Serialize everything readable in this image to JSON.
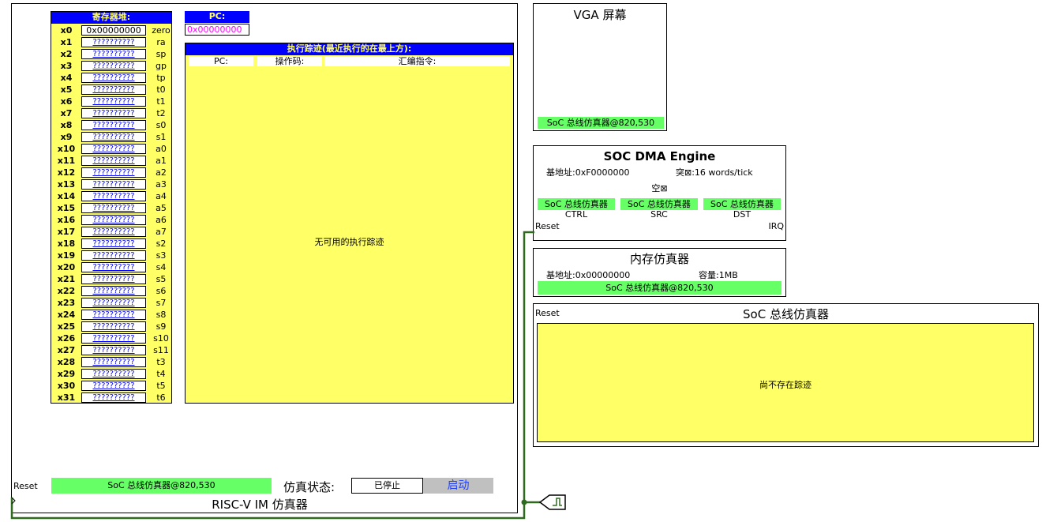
{
  "registers": {
    "title": "寄存器堆:",
    "rows": [
      {
        "name": "x0",
        "value": "0x00000000",
        "abi": "zero"
      },
      {
        "name": "x1",
        "value": "??????????",
        "abi": "ra"
      },
      {
        "name": "x2",
        "value": "??????????",
        "abi": "sp"
      },
      {
        "name": "x3",
        "value": "??????????",
        "abi": "gp"
      },
      {
        "name": "x4",
        "value": "??????????",
        "abi": "tp"
      },
      {
        "name": "x5",
        "value": "??????????",
        "abi": "t0"
      },
      {
        "name": "x6",
        "value": "??????????",
        "abi": "t1"
      },
      {
        "name": "x7",
        "value": "??????????",
        "abi": "t2"
      },
      {
        "name": "x8",
        "value": "??????????",
        "abi": "s0"
      },
      {
        "name": "x9",
        "value": "??????????",
        "abi": "s1"
      },
      {
        "name": "x10",
        "value": "??????????",
        "abi": "a0"
      },
      {
        "name": "x11",
        "value": "??????????",
        "abi": "a1"
      },
      {
        "name": "x12",
        "value": "??????????",
        "abi": "a2"
      },
      {
        "name": "x13",
        "value": "??????????",
        "abi": "a3"
      },
      {
        "name": "x14",
        "value": "??????????",
        "abi": "a4"
      },
      {
        "name": "x15",
        "value": "??????????",
        "abi": "a5"
      },
      {
        "name": "x16",
        "value": "??????????",
        "abi": "a6"
      },
      {
        "name": "x17",
        "value": "??????????",
        "abi": "a7"
      },
      {
        "name": "x18",
        "value": "??????????",
        "abi": "s2"
      },
      {
        "name": "x19",
        "value": "??????????",
        "abi": "s3"
      },
      {
        "name": "x20",
        "value": "??????????",
        "abi": "s4"
      },
      {
        "name": "x21",
        "value": "??????????",
        "abi": "s5"
      },
      {
        "name": "x22",
        "value": "??????????",
        "abi": "s6"
      },
      {
        "name": "x23",
        "value": "??????????",
        "abi": "s7"
      },
      {
        "name": "x24",
        "value": "??????????",
        "abi": "s8"
      },
      {
        "name": "x25",
        "value": "??????????",
        "abi": "s9"
      },
      {
        "name": "x26",
        "value": "??????????",
        "abi": "s10"
      },
      {
        "name": "x27",
        "value": "??????????",
        "abi": "s11"
      },
      {
        "name": "x28",
        "value": "??????????",
        "abi": "t3"
      },
      {
        "name": "x29",
        "value": "??????????",
        "abi": "t4"
      },
      {
        "name": "x30",
        "value": "??????????",
        "abi": "t5"
      },
      {
        "name": "x31",
        "value": "??????????",
        "abi": "t6"
      }
    ]
  },
  "pc": {
    "title": "PC:",
    "value": "0x00000000"
  },
  "trace": {
    "title": "执行踪迹(最近执行的在最上方):",
    "col_pc": "PC:",
    "col_opcode": "操作码:",
    "col_asm": "汇编指令:",
    "empty": "无可用的执行踪迹"
  },
  "cpu": {
    "reset_label": "Reset",
    "bus_label": "SoC 总线仿真器@820,530",
    "sim_state_label": "仿真状态:",
    "sim_state_value": "已停止",
    "start_button": "启动",
    "title": "RISC-V IM 仿真器"
  },
  "vga": {
    "title": "VGA 屏幕",
    "bus_label": "SoC 总线仿真器@820,530"
  },
  "dma": {
    "title": "SOC DMA Engine",
    "base": "基地址:0xF0000000",
    "burst": "突⊠:16 words/tick",
    "state": "空⊠",
    "bus_ctrl": "SoC 总线仿真器",
    "bus_src": "SoC 总线仿真器",
    "bus_dst": "SoC 总线仿真器",
    "label_ctrl": "CTRL",
    "label_src": "SRC",
    "label_dst": "DST",
    "reset_label": "Reset",
    "irq_label": "IRQ"
  },
  "memory": {
    "title": "内存仿真器",
    "base": "基地址:0x00000000",
    "capacity": "容量:1MB",
    "bus_label": "SoC 总线仿真器@820,530"
  },
  "bus": {
    "reset_label": "Reset",
    "title": "SoC 总线仿真器",
    "empty": "尚不存在踪迹"
  },
  "colors": {
    "wire": "#2e6b1f",
    "yellow": "#ffff66",
    "green": "#66ff66",
    "blue": "#0000ff"
  }
}
